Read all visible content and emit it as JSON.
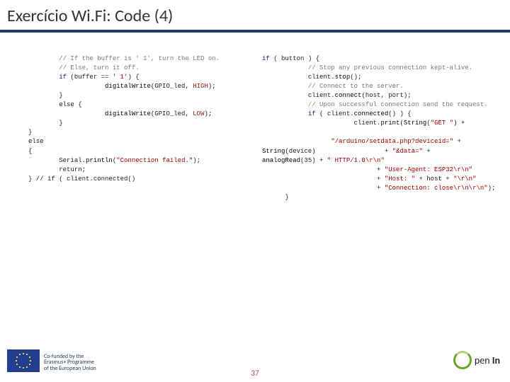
{
  "title": "Exercício Wi.Fi: Code (4)",
  "code_left": {
    "l01": "// If the buffer is ' 1', turn the LED on.",
    "l02": "// Else, turn it off.",
    "l03a": "if",
    "l03b": " (buffer == ",
    "l03c": "' 1'",
    "l03d": ") {",
    "l04a": "digitalWrite",
    "l04b": "(GPIO_led, ",
    "l04c": "HIGH",
    "l04d": ");",
    "l05": "}",
    "l06": "else {",
    "l07a": "digitalWrite",
    "l07b": "(GPIO_led, ",
    "l07c": "LOW",
    "l07d": ");",
    "l08": "}",
    "l09": "}",
    "l10": "else",
    "l11": "{",
    "l12a": "Serial.",
    "l12b": "println",
    "l12c": "(",
    "l12d": "\"Connection failed.\"",
    "l12e": ");",
    "l13": "return;",
    "l14": "} // if ( client.connected()"
  },
  "code_right": {
    "r01a": "if",
    "r01b": " ( button ) {",
    "r02": "// Stop any previous connection kept-alive.",
    "r03a": "client.",
    "r03b": "stop",
    "r03c": "();",
    "r04": "// Connect to the server.",
    "r05a": "client.",
    "r05b": "connect",
    "r05c": "(host, port);",
    "r06": "// Upon successful connection send the request.",
    "r07a": "if",
    "r07b": " ( client.",
    "r07c": "connected",
    "r07d": "() ) {",
    "r08a": "client.",
    "r08b": "print",
    "r08c": "(",
    "r08d": "String",
    "r08e": "(",
    "r08f": "\"GET \"",
    "r08g": ") +",
    "r09a": "\"/arduino/setdata.php?deviceid=\"",
    "r09b": " +",
    "r10a": "String",
    "r10b": "(device)",
    "r10c": "                  + ",
    "r10d": "\"&data=\"",
    "r10e": " +",
    "r11a": "analogRead",
    "r11b": "(35) + ",
    "r11c": "\" HTTP/1.0\\r\\n\"",
    "r12a": "+ ",
    "r12b": "\"User-Agent: ESP32\\r\\n\"",
    "r13a": "+ ",
    "r13b": "\"Host: \"",
    "r13c": " + host + ",
    "r13d": "\"\\r\\n\"",
    "r14a": "+ ",
    "r14b": "\"Connection: close\\r\\n\\r\\n\"",
    "r14c": ");",
    "r15": "}"
  },
  "footer": {
    "cofunded": "Co-funded by the\nErasmus+ Programme\nof the European Union",
    "brand_pen": "pen",
    "brand_in": "In",
    "page": "37"
  }
}
